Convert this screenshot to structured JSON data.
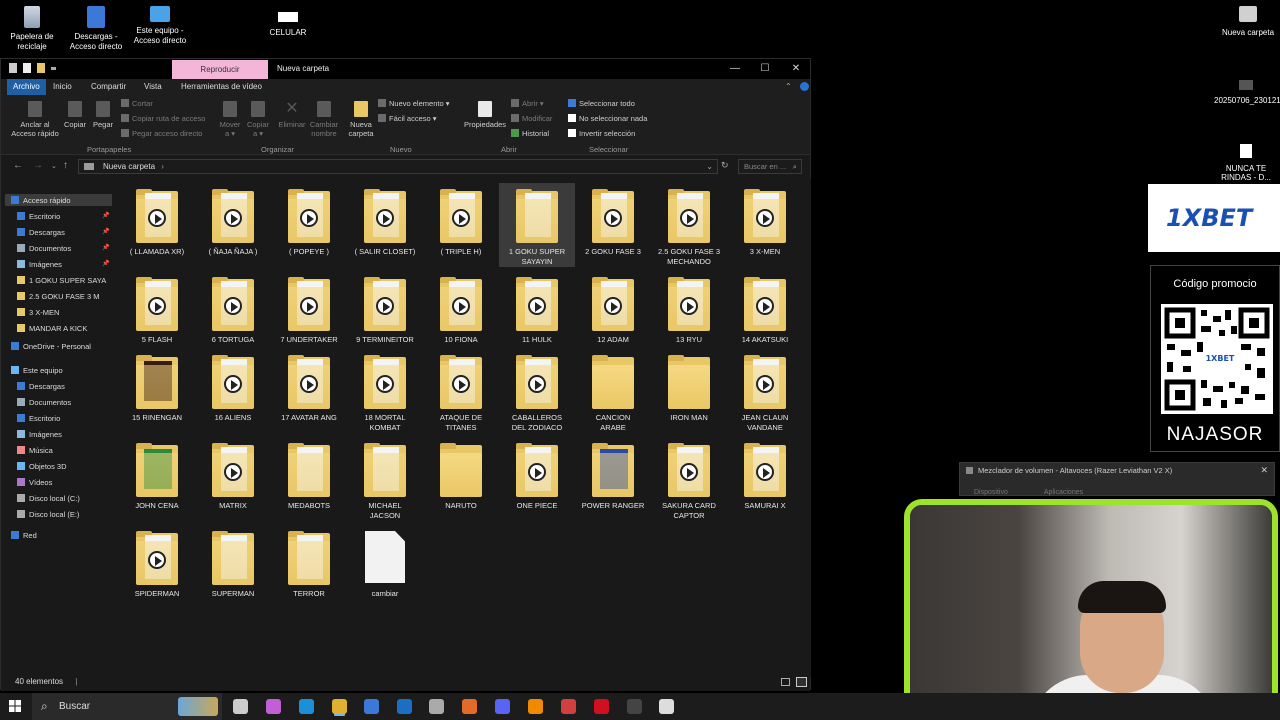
{
  "desktop": {
    "icons": [
      {
        "label_line1": "Papelera de",
        "label_line2": "reciclaje",
        "icon": "recycle-bin-icon"
      },
      {
        "label_line1": "Descargas -",
        "label_line2": "Acceso directo",
        "icon": "downloads-shortcut-icon"
      },
      {
        "label_line1": "Este equipo -",
        "label_line2": "Acceso directo",
        "icon": "this-pc-shortcut-icon"
      },
      {
        "label_line1": "CELULAR",
        "label_line2": "",
        "icon": "usb-drive-icon"
      },
      {
        "label_line1": "Nueva carpeta",
        "label_line2": "",
        "icon": "folder-icon"
      }
    ],
    "side_items": [
      {
        "label": "20250706_230121",
        "icon": "video-file-icon"
      },
      {
        "label_line1": "NUNCA TE",
        "label_line2": "RINDAS - D...",
        "icon": "video-file-icon"
      }
    ]
  },
  "explorer": {
    "context_tab": "Reproducir",
    "title": "Nueva carpeta",
    "window_buttons": {
      "minimize": "—",
      "maximize": "☐",
      "close": "✕"
    },
    "tabs": [
      "Archivo",
      "Inicio",
      "Compartir",
      "Vista",
      "Herramientas de vídeo"
    ],
    "ribbon": {
      "portapapeles": {
        "group": "Portapapeles",
        "anclar_line1": "Anclar al",
        "anclar_line2": "Acceso rápido",
        "copiar": "Copiar",
        "pegar": "Pegar",
        "cortar": "Cortar",
        "copiar_ruta": "Copiar ruta de acceso",
        "pegar_acceso": "Pegar acceso directo"
      },
      "organizar": {
        "group": "Organizar",
        "mover_line1": "Mover",
        "mover_line2": "a ▾",
        "copiar_line1": "Copiar",
        "copiar_line2": "a ▾",
        "eliminar": "Eliminar",
        "cambiar_line1": "Cambiar",
        "cambiar_line2": "nombre"
      },
      "nuevo": {
        "group": "Nuevo",
        "nueva_line1": "Nueva",
        "nueva_line2": "carpeta",
        "nuevo_elemento": "Nuevo elemento ▾",
        "facil_acceso": "Fácil acceso ▾"
      },
      "abrir": {
        "group": "Abrir",
        "propiedades": "Propiedades",
        "abrir": "Abrir ▾",
        "modificar": "Modificar",
        "historial": "Historial"
      },
      "seleccionar": {
        "group": "Seleccionar",
        "todo": "Seleccionar todo",
        "nada": "No seleccionar nada",
        "invertir": "Invertir selección"
      }
    },
    "address": {
      "path": "Nueva carpeta",
      "separator": "›",
      "search_placeholder": "Buscar en ..."
    },
    "nav": [
      {
        "label": "Acceso rápido",
        "icon": "star-icon",
        "selected": true,
        "pinned": false
      },
      {
        "label": "Escritorio",
        "icon": "desktop-icon",
        "pinned": true
      },
      {
        "label": "Descargas",
        "icon": "download-icon",
        "pinned": true
      },
      {
        "label": "Documentos",
        "icon": "documents-icon",
        "pinned": true
      },
      {
        "label": "Imágenes",
        "icon": "pictures-icon",
        "pinned": true
      },
      {
        "label": "1 GOKU SUPER SAYA",
        "icon": "folder-icon",
        "pinned": false
      },
      {
        "label": "2.5 GOKU FASE 3  M",
        "icon": "folder-icon",
        "pinned": false
      },
      {
        "label": "3 X-MEN",
        "icon": "folder-icon",
        "pinned": false
      },
      {
        "label": "MANDAR A KICK",
        "icon": "folder-icon",
        "pinned": false
      },
      {
        "label": "OneDrive - Personal",
        "icon": "cloud-icon",
        "pinned": false
      },
      {
        "label": "Este equipo",
        "icon": "pc-icon",
        "pinned": false
      },
      {
        "label": "Descargas",
        "icon": "download-icon",
        "pinned": false
      },
      {
        "label": "Documentos",
        "icon": "documents-icon",
        "pinned": false
      },
      {
        "label": "Escritorio",
        "icon": "desktop-icon",
        "pinned": false
      },
      {
        "label": "Imágenes",
        "icon": "pictures-icon",
        "pinned": false
      },
      {
        "label": "Música",
        "icon": "music-icon",
        "pinned": false
      },
      {
        "label": "Objetos 3D",
        "icon": "cube-icon",
        "pinned": false
      },
      {
        "label": "Vídeos",
        "icon": "video-icon",
        "pinned": false
      },
      {
        "label": "Disco local (C:)",
        "icon": "drive-icon",
        "pinned": false
      },
      {
        "label": "Disco local (E:)",
        "icon": "drive-icon",
        "pinned": false
      },
      {
        "label": "Red",
        "icon": "network-icon",
        "pinned": false
      }
    ],
    "items": [
      {
        "l1": "( LLAMADA XR)",
        "l2": "",
        "kind": "play"
      },
      {
        "l1": "( ÑAJA ÑAJA )",
        "l2": "",
        "kind": "play"
      },
      {
        "l1": "( POPEYE )",
        "l2": "",
        "kind": "play"
      },
      {
        "l1": "( SALIR CLOSET)",
        "l2": "",
        "kind": "play"
      },
      {
        "l1": "( TRIPLE H)",
        "l2": "",
        "kind": "play"
      },
      {
        "l1": "1 GOKU SUPER",
        "l2": "SAYAYIN",
        "kind": "plain"
      },
      {
        "l1": "2 GOKU FASE 3",
        "l2": "",
        "kind": "play"
      },
      {
        "l1": "2.5 GOKU FASE 3",
        "l2": "MECHANDO",
        "kind": "play"
      },
      {
        "l1": "3 X-MEN",
        "l2": "",
        "kind": "play"
      },
      {
        "l1": "5 FLASH",
        "l2": "",
        "kind": "play"
      },
      {
        "l1": "6 TORTUGA",
        "l2": "",
        "kind": "play"
      },
      {
        "l1": "7 UNDERTAKER",
        "l2": "",
        "kind": "play"
      },
      {
        "l1": "9 TERMINEITOR",
        "l2": "",
        "kind": "play"
      },
      {
        "l1": "10 FIONA",
        "l2": "",
        "kind": "play"
      },
      {
        "l1": "11 HULK",
        "l2": "",
        "kind": "play"
      },
      {
        "l1": "12 ADAM",
        "l2": "",
        "kind": "play"
      },
      {
        "l1": "13 RYU",
        "l2": "",
        "kind": "play"
      },
      {
        "l1": "14 AKATSUKI",
        "l2": "",
        "kind": "play"
      },
      {
        "l1": "15 RINENGAN",
        "l2": "",
        "kind": "thumb-dark"
      },
      {
        "l1": "16 ALIENS",
        "l2": "",
        "kind": "play"
      },
      {
        "l1": "17 AVATAR ANG",
        "l2": "",
        "kind": "play"
      },
      {
        "l1": "18 MORTAL",
        "l2": "KOMBAT",
        "kind": "play"
      },
      {
        "l1": "ATAQUE DE",
        "l2": "TITANES",
        "kind": "play"
      },
      {
        "l1": "CABALLEROS",
        "l2": "DEL ZODIACO",
        "kind": "play"
      },
      {
        "l1": "CANCION",
        "l2": "ARABE",
        "kind": "empty"
      },
      {
        "l1": "IRON MAN",
        "l2": "",
        "kind": "empty"
      },
      {
        "l1": "JEAN CLAUN",
        "l2": "VANDANE",
        "kind": "play"
      },
      {
        "l1": "JOHN CENA",
        "l2": "",
        "kind": "thumb-green"
      },
      {
        "l1": "MATRIX",
        "l2": "",
        "kind": "play"
      },
      {
        "l1": "MEDABOTS",
        "l2": "",
        "kind": "plain"
      },
      {
        "l1": "MICHAEL",
        "l2": "JACSON",
        "kind": "plain"
      },
      {
        "l1": "NARUTO",
        "l2": "",
        "kind": "empty"
      },
      {
        "l1": "ONE PIECE",
        "l2": "",
        "kind": "play"
      },
      {
        "l1": "POWER RANGER",
        "l2": "",
        "kind": "thumb-blue"
      },
      {
        "l1": "SAKURA CARD",
        "l2": "CAPTOR",
        "kind": "play"
      },
      {
        "l1": "SAMURAI X",
        "l2": "",
        "kind": "play"
      },
      {
        "l1": "SPIDERMAN",
        "l2": "",
        "kind": "play"
      },
      {
        "l1": "SUPERMAN",
        "l2": "",
        "kind": "plain"
      },
      {
        "l1": "TERROR",
        "l2": "",
        "kind": "plain"
      },
      {
        "l1": "cambiar",
        "l2": "",
        "kind": "file"
      }
    ],
    "status": "40 elementos"
  },
  "ads": {
    "brand": "1XBET",
    "promo_title": "Código promocio",
    "promo_code": "NAJASOR"
  },
  "mixer": {
    "title": "Mezclador de volumen - Altavoces (Razer Leviathan V2 X)",
    "tab1": "Dispositivo",
    "tab2": "Aplicaciones",
    "close": "✕"
  },
  "taskbar": {
    "search_label": "Buscar",
    "pinned": [
      "widgets-icon",
      "task-view-icon",
      "copilot-icon",
      "edge-icon",
      "file-explorer-icon",
      "store-icon",
      "outlook-icon",
      "tools-icon",
      "firefox-icon",
      "discord-icon",
      "vlc-icon",
      "app-red-icon",
      "opera-icon",
      "obs-icon",
      "shield-icon"
    ]
  },
  "colors": {
    "accent": "#1f5fa6",
    "context_tab": "#f4b6d8",
    "webcam_border": "#9de22c",
    "folder": "#e8c767"
  }
}
